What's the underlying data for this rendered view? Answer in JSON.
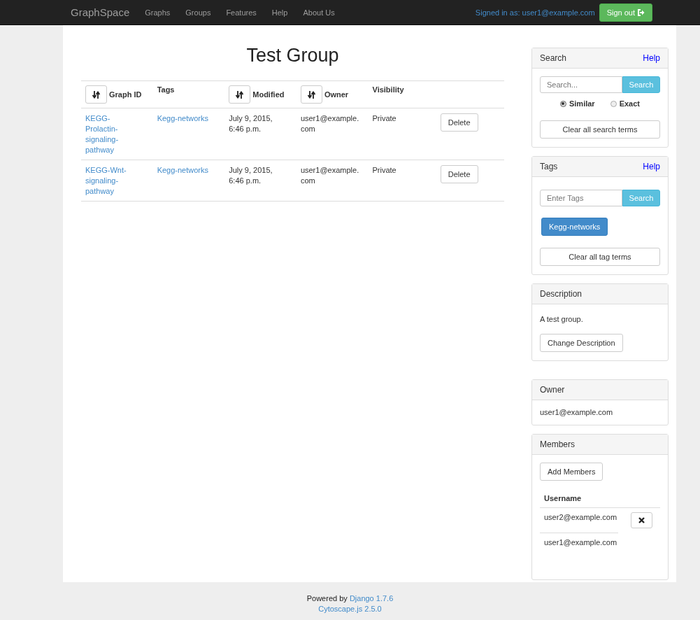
{
  "navbar": {
    "brand": "GraphSpace",
    "links": [
      "Graphs",
      "Groups",
      "Features",
      "Help",
      "About Us"
    ],
    "signed_in": "Signed in as: user1@example.com",
    "sign_out": "Sign out"
  },
  "title": "Test Group",
  "table": {
    "columns": [
      {
        "label": "Graph ID",
        "sortable": true
      },
      {
        "label": "Tags",
        "sortable": false
      },
      {
        "label": "Modified",
        "sortable": true
      },
      {
        "label": "Owner",
        "sortable": true
      },
      {
        "label": "Visibility",
        "sortable": false
      }
    ],
    "rows": [
      {
        "graph_id": "KEGG-Prolactin-signaling-pathway",
        "tags": "Kegg-networks",
        "modified": "July 9, 2015, 6:46 p.m.",
        "owner": "user1@example.com",
        "visibility": "Private",
        "action": "Delete"
      },
      {
        "graph_id": "KEGG-Wnt-signaling-pathway",
        "tags": "Kegg-networks",
        "modified": "July 9, 2015, 6:46 p.m.",
        "owner": "user1@example.com",
        "visibility": "Private",
        "action": "Delete"
      }
    ]
  },
  "search_panel": {
    "title": "Search",
    "help": "Help",
    "placeholder": "Search...",
    "button": "Search",
    "modes": [
      {
        "label": "Similar",
        "selected": true
      },
      {
        "label": "Exact",
        "selected": false
      }
    ],
    "clear": "Clear all search terms"
  },
  "tags_panel": {
    "title": "Tags",
    "help": "Help",
    "placeholder": "Enter Tags",
    "button": "Search",
    "tags": [
      "Kegg-networks"
    ],
    "clear": "Clear all tag terms"
  },
  "description_panel": {
    "title": "Description",
    "text": "A test group.",
    "button": "Change Description"
  },
  "owner_panel": {
    "title": "Owner",
    "owner": "user1@example.com"
  },
  "members_panel": {
    "title": "Members",
    "button": "Add Members",
    "column": "Username",
    "members": [
      {
        "username": "user2@example.com",
        "removable": true
      },
      {
        "username": "user1@example.com",
        "removable": false
      }
    ]
  },
  "footer": {
    "powered_by": "Powered by",
    "django": "Django 1.7.6",
    "cytoscape": "Cytoscape.js 2.5.0"
  }
}
